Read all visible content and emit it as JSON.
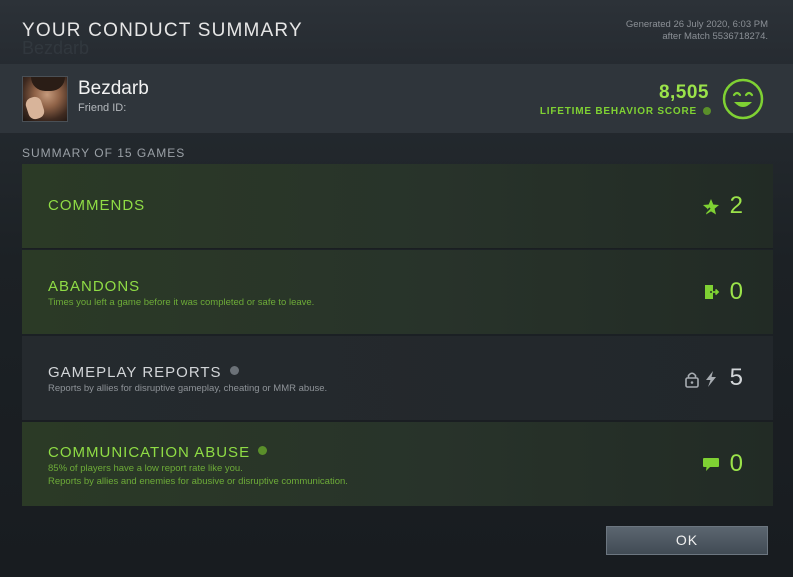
{
  "dialog": {
    "title": "YOUR CONDUCT SUMMARY",
    "generated_line1": "Generated 26 July 2020, 6:03 PM",
    "generated_line2": "after Match 5536718274.",
    "background_ghost_text": "Bezdarb"
  },
  "player": {
    "name": "Bezdarb",
    "friend_id_label": "Friend ID:",
    "score": "8,505",
    "score_label": "LIFETIME BEHAVIOR SCORE",
    "smiley_icon": "smiley-face-icon"
  },
  "summary": {
    "title": "SUMMARY OF 15 GAMES",
    "rows": [
      {
        "title": "COMMENDS",
        "desc1": "",
        "desc2": "",
        "value": "2",
        "icon": "star-icon"
      },
      {
        "title": "ABANDONS",
        "desc1": "Times you left a game before it was completed or safe to leave.",
        "desc2": "",
        "value": "0",
        "icon": "exit-door-icon"
      },
      {
        "title": "GAMEPLAY REPORTS",
        "desc1": "Reports by allies for disruptive gameplay, cheating or MMR abuse.",
        "desc2": "",
        "value": "5",
        "icon": "lock-lightning-icon"
      },
      {
        "title": "COMMUNICATION ABUSE",
        "desc1": "85% of players have a low report rate like you.",
        "desc2": "Reports by allies and enemies for abusive or disruptive communication.",
        "value": "0",
        "icon": "chat-bubble-icon"
      }
    ]
  },
  "footer": {
    "ok_label": "OK"
  },
  "colors": {
    "accent_green": "#9be34a",
    "label_green": "#7fd133",
    "text_light": "#f2f2f2",
    "text_muted": "#8e9398"
  }
}
